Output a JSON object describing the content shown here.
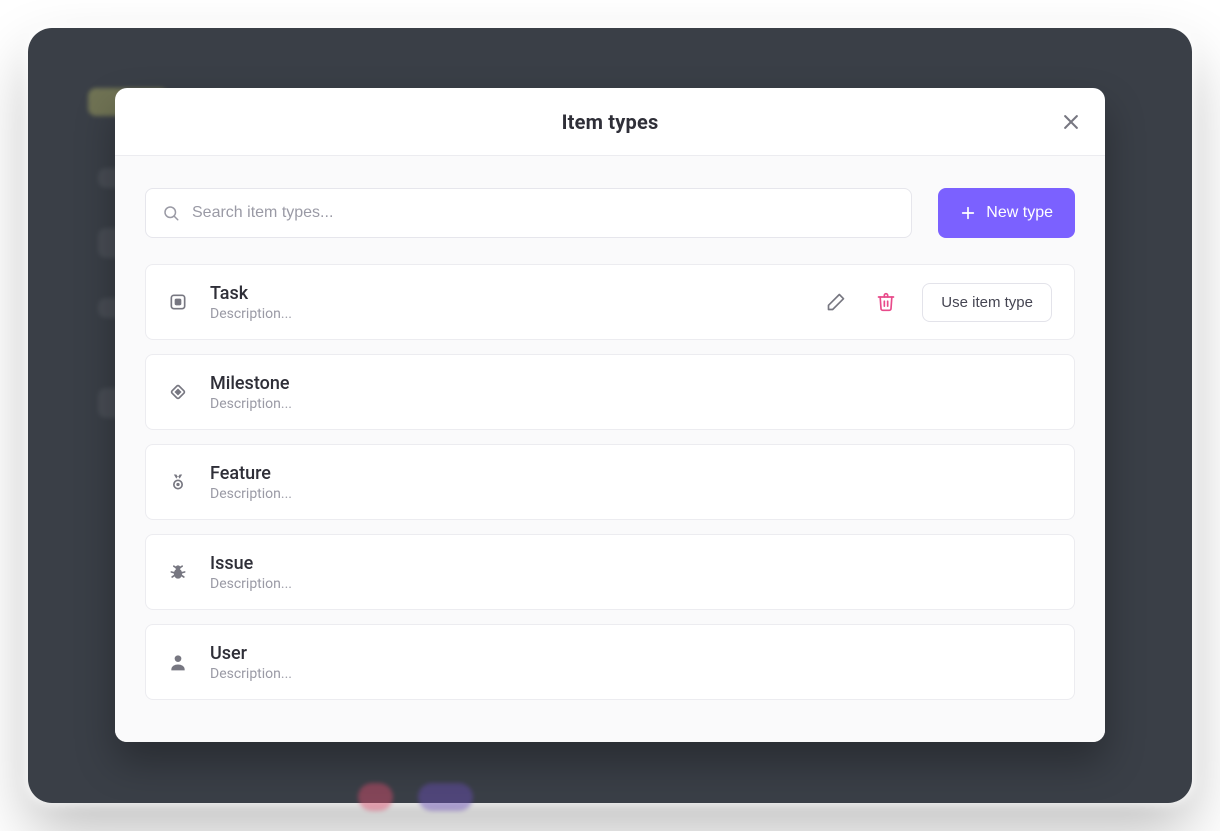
{
  "modal": {
    "title": "Item types",
    "search_placeholder": "Search item types...",
    "new_button_label": "New type",
    "use_button_label": "Use item type"
  },
  "item_types": [
    {
      "icon": "square",
      "name": "Task",
      "description": "Description...",
      "hovered": true
    },
    {
      "icon": "diamond",
      "name": "Milestone",
      "description": "Description...",
      "hovered": false
    },
    {
      "icon": "medal",
      "name": "Feature",
      "description": "Description...",
      "hovered": false
    },
    {
      "icon": "bug",
      "name": "Issue",
      "description": "Description...",
      "hovered": false
    },
    {
      "icon": "user",
      "name": "User",
      "description": "Description...",
      "hovered": false
    }
  ],
  "colors": {
    "accent": "#7b61ff",
    "danger": "#e84a8a",
    "text": "#2f2f38",
    "muted": "#9a9aa5"
  }
}
